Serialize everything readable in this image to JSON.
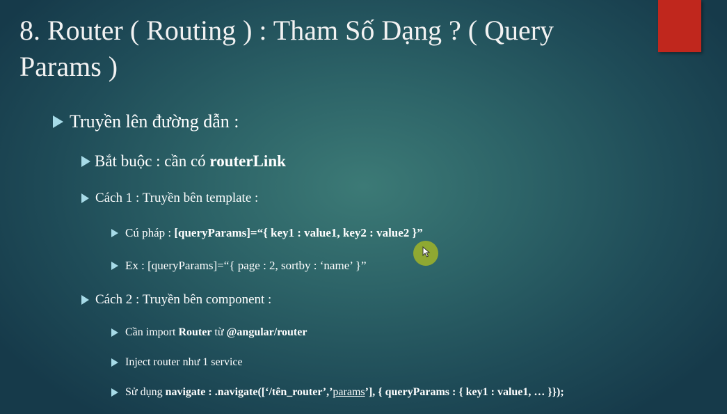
{
  "slide": {
    "title": "8. Router ( Routing ) : Tham Số Dạng ? ( Query Params )",
    "items": {
      "l1": {
        "text": "Truyền lên đường dẫn :"
      },
      "required": {
        "prefix": "Bắt buộc : cần có ",
        "bold": "routerLink"
      },
      "way1": {
        "text": "Cách 1 : Truyền bên template :"
      },
      "syntax": {
        "prefix": "Cú pháp : ",
        "bold": "[queryParams]=“{ key1 : value1, key2 : value2 }”"
      },
      "example": {
        "text": "Ex : [queryParams]=“{ page : 2, sortby : ‘name’ }”"
      },
      "way2": {
        "text": "Cách 2 : Truyền bên component :"
      },
      "import": {
        "prefix": "Cần import ",
        "bold1": "Router",
        "mid": " từ ",
        "bold2": "@angular/router"
      },
      "inject": {
        "text": "Inject router như 1 service"
      },
      "usage": {
        "prefix": "Sử dụng ",
        "bold1": "navigate",
        "bold2": " : .navigate([‘/tên_router’,’",
        "underlined": "params",
        "bold3": "’], { queryParams : { key1 : value1, … }});"
      }
    }
  },
  "colors": {
    "accent": "#c0271d",
    "bullet": "#a7dbe8",
    "cursor": "#a0b428"
  },
  "icons": {
    "bullet": "triangle-bullet-icon",
    "cursor": "mouse-cursor-icon"
  }
}
